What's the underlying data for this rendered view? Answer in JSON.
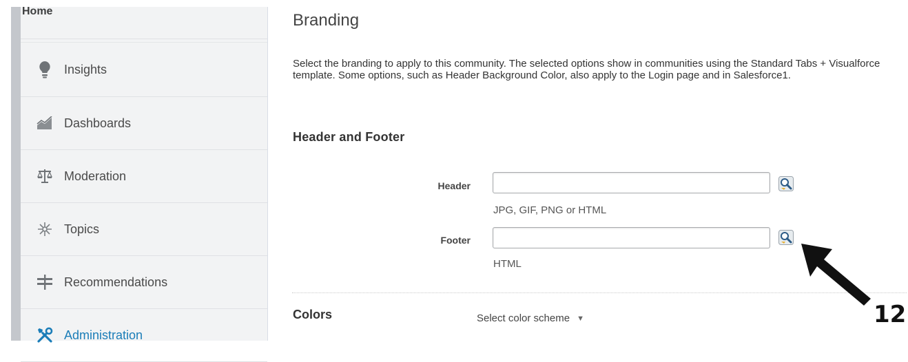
{
  "sidebar": {
    "home_label": "Home",
    "items": [
      {
        "label": "Insights",
        "icon": "lightbulb-icon"
      },
      {
        "label": "Dashboards",
        "icon": "area-chart-icon"
      },
      {
        "label": "Moderation",
        "icon": "scales-icon"
      },
      {
        "label": "Topics",
        "icon": "topics-icon"
      },
      {
        "label": "Recommendations",
        "icon": "signpost-icon"
      },
      {
        "label": "Administration",
        "icon": "wrench-screwdriver-icon"
      }
    ]
  },
  "main": {
    "title": "Branding",
    "description": "Select the branding to apply to this community. The selected options show in communities using the Standard Tabs + Visualforce template. Some options, such as Header Background Color, also apply to the Login page and in Salesforce1.",
    "section_header": "Header and Footer",
    "header_field": {
      "label": "Header",
      "value": "",
      "hint": "JPG, GIF, PNG or HTML"
    },
    "footer_field": {
      "label": "Footer",
      "value": "",
      "hint": "HTML"
    },
    "colors_label": "Colors",
    "color_scheme_select": "Select color scheme"
  },
  "annotation": {
    "number": "12"
  },
  "colors": {
    "active_link": "#1b7db8",
    "sidebar_bg": "#f2f3f4"
  }
}
